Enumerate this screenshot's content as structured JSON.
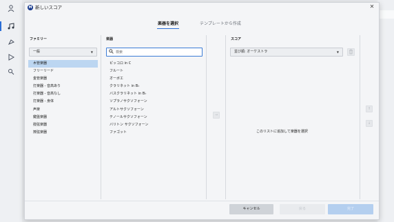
{
  "dialog": {
    "title": "新しいスコア",
    "logo_letter": "M",
    "close_glyph": "✕"
  },
  "tabs": [
    {
      "label": "楽器を選択",
      "active": true
    },
    {
      "label": "テンプレートから作成",
      "active": false
    }
  ],
  "family": {
    "header": "ファミリー",
    "selected_group": "一般",
    "items": [
      {
        "label": "木管楽器",
        "selected": true
      },
      {
        "label": "フリーリード",
        "selected": false
      },
      {
        "label": "金管楽器",
        "selected": false
      },
      {
        "label": "打楽器 - 音高あり",
        "selected": false
      },
      {
        "label": "打楽器 - 音高なし",
        "selected": false
      },
      {
        "label": "打楽器 - 身体",
        "selected": false
      },
      {
        "label": "声楽",
        "selected": false
      },
      {
        "label": "鍵盤楽器",
        "selected": false
      },
      {
        "label": "撥弦楽器",
        "selected": false
      },
      {
        "label": "擦弦楽器",
        "selected": false
      }
    ]
  },
  "instruments": {
    "header": "楽器",
    "search_placeholder": "検索",
    "items": [
      "ピッコロ in C",
      "フルート",
      "オーボエ",
      "クラリネット in B♭",
      "バスクラリネット in B♭",
      "ソプラノサクソフォーン",
      "アルトサクソフォーン",
      "テノールサクソフォーン",
      "バリトン サクソフォーン",
      "ファゴット"
    ]
  },
  "score": {
    "header": "スコア",
    "order_value": "並び順: オーケストラ",
    "empty_message": "このリストに追加して楽器を選択"
  },
  "buttons": {
    "cancel": "キャンセル",
    "back": "戻る",
    "done": "完了"
  },
  "icons": {
    "arrow_right": "→",
    "arrow_up": "↑",
    "arrow_down": "↓",
    "delete": "🗑"
  },
  "colors": {
    "accent": "#2a6ed6",
    "selected_row": "#bcd6f1",
    "done_button": "#b4cfef"
  }
}
